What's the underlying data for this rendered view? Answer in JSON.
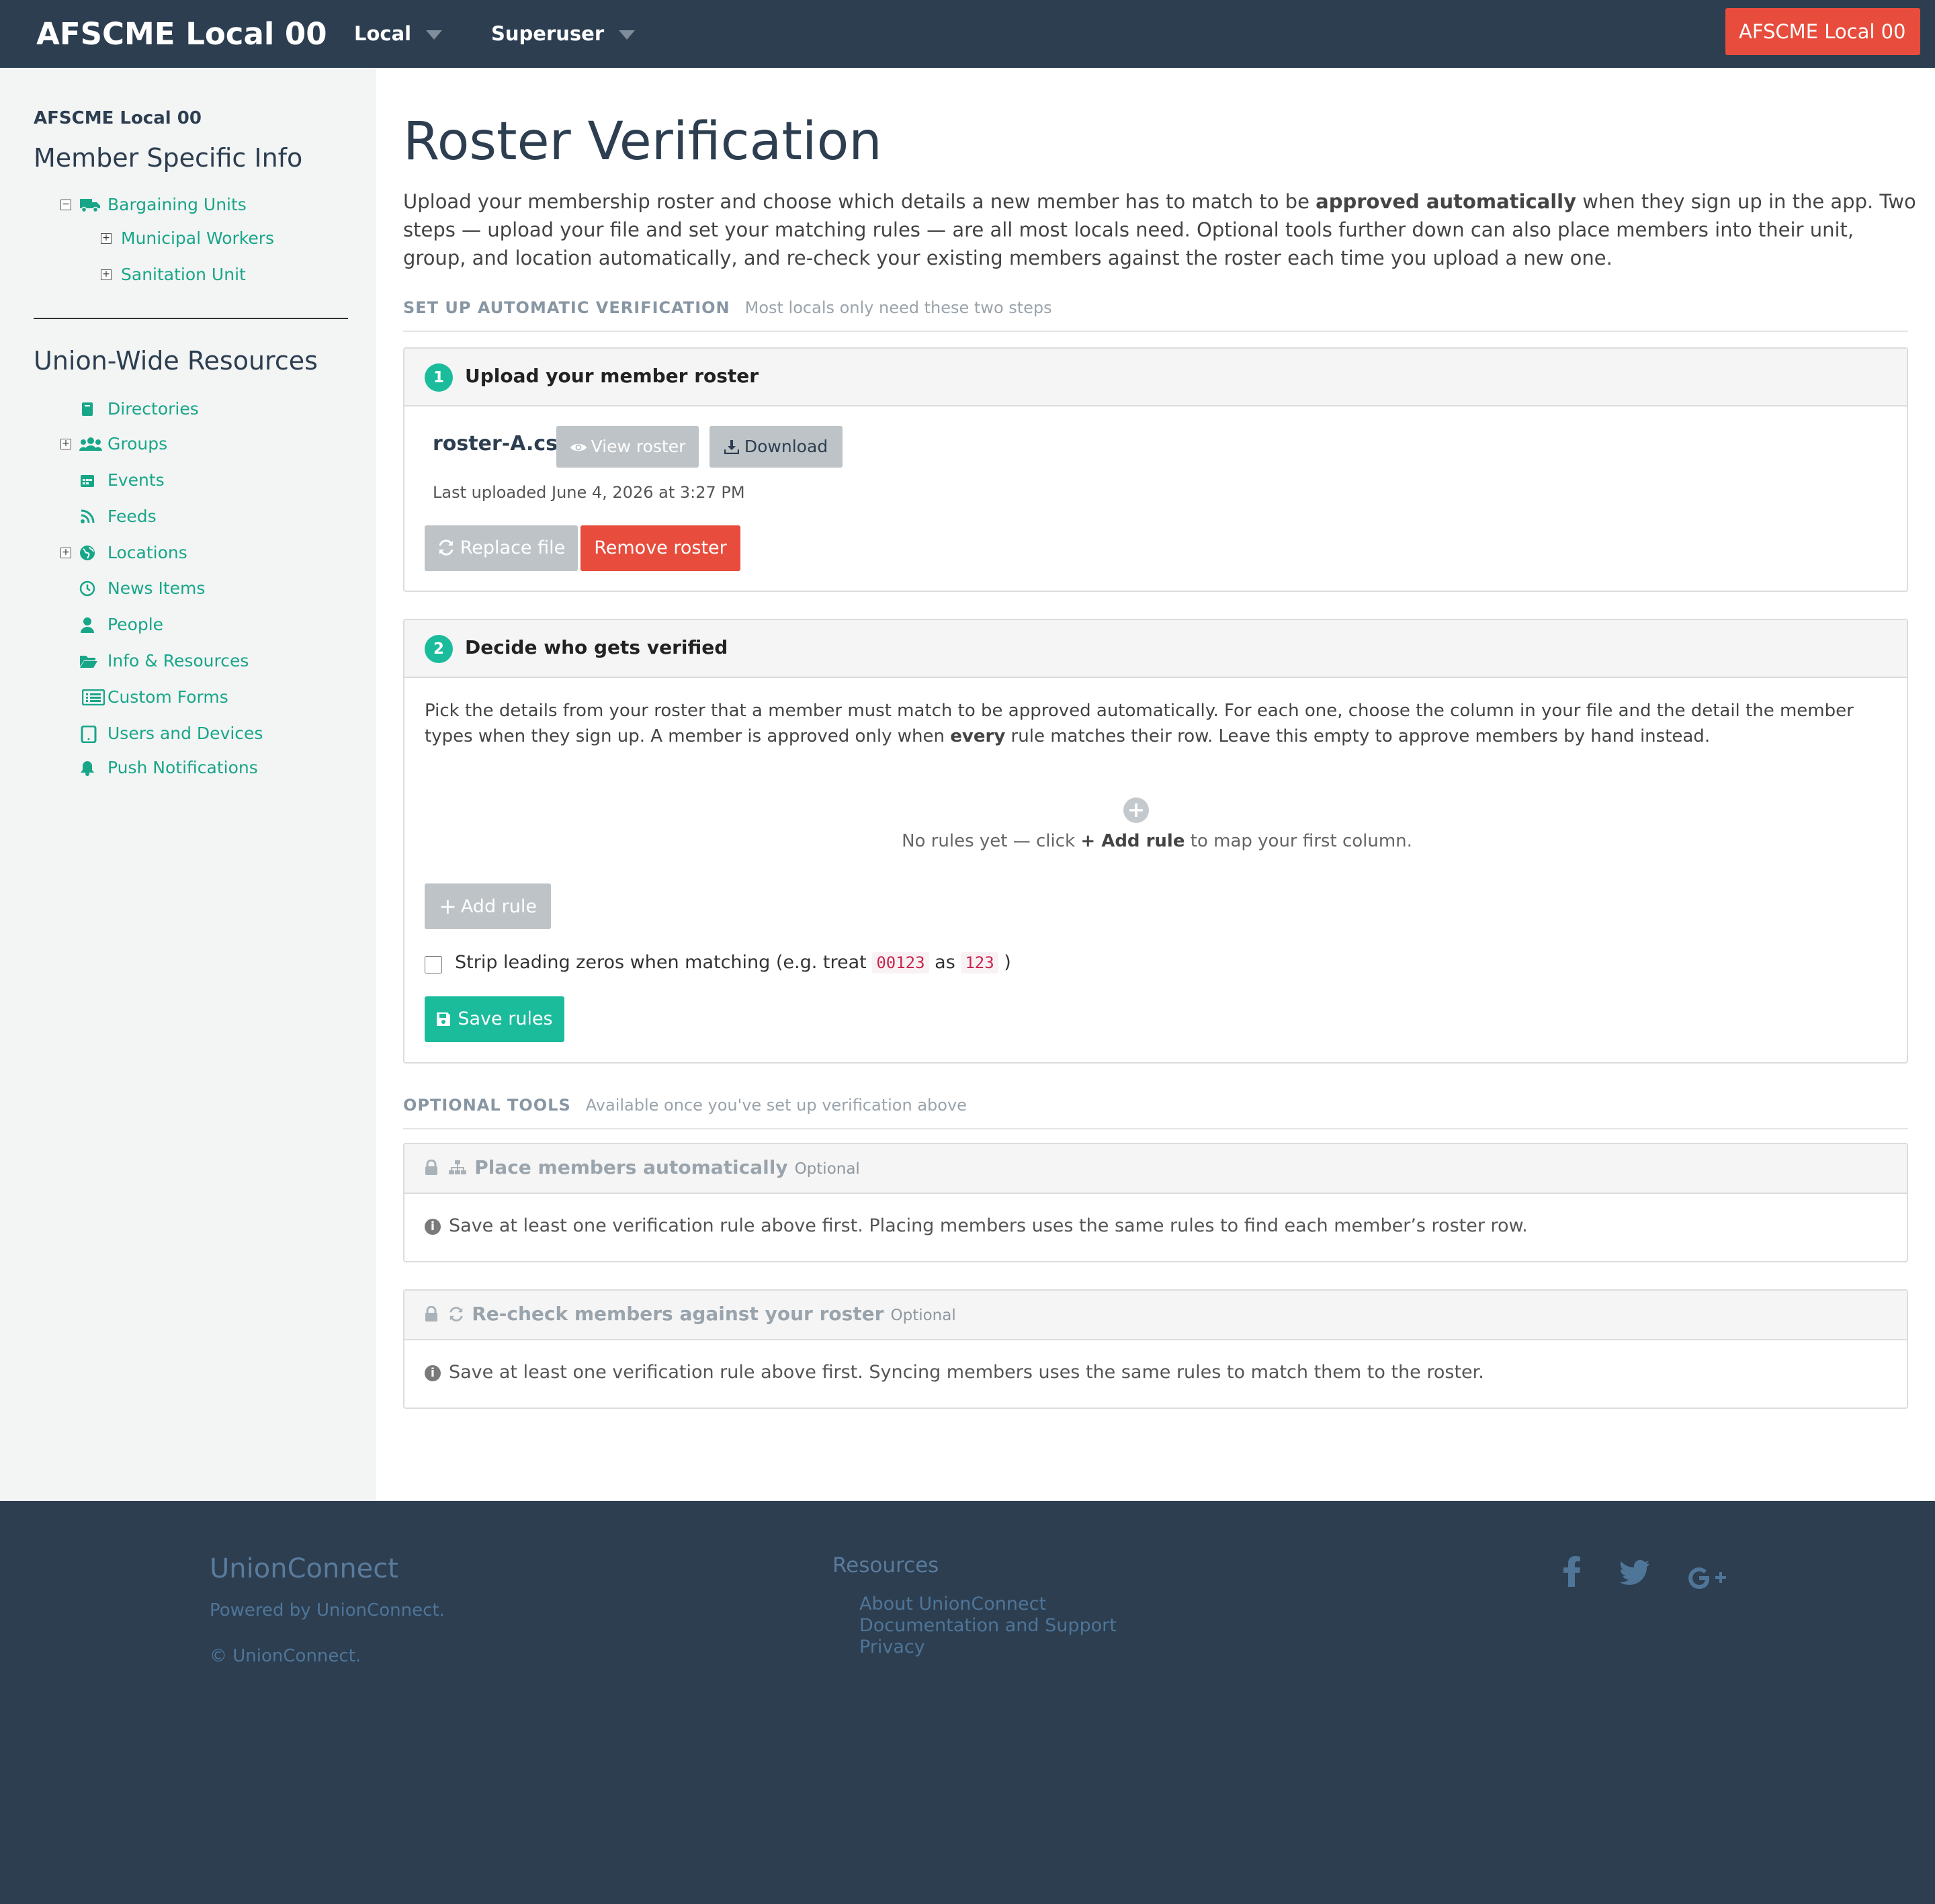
{
  "navbar": {
    "brand": "AFSCME Local 00",
    "local_menu": "Local",
    "superuser_menu": "Superuser",
    "account_button": "AFSCME Local 00"
  },
  "sidebar": {
    "local_name": "AFSCME Local 00",
    "member_heading": "Member Specific Info",
    "bargaining_units": "Bargaining Units",
    "units": [
      "Municipal Workers",
      "Sanitation Unit"
    ],
    "union_heading": "Union-Wide Resources",
    "resources": [
      {
        "label": "Directories",
        "icon": "book-icon"
      },
      {
        "label": "Groups",
        "icon": "users-icon"
      },
      {
        "label": "Events",
        "icon": "calendar-icon"
      },
      {
        "label": "Feeds",
        "icon": "rss-icon"
      },
      {
        "label": "Locations",
        "icon": "globe-icon"
      },
      {
        "label": "News Items",
        "icon": "clock-icon"
      },
      {
        "label": "People",
        "icon": "person-icon"
      },
      {
        "label": "Info & Resources",
        "icon": "folder-icon"
      },
      {
        "label": "Custom Forms",
        "icon": "form-list-icon"
      },
      {
        "label": "Users and Devices",
        "icon": "tablet-icon"
      },
      {
        "label": "Push Notifications",
        "icon": "bell-icon"
      }
    ]
  },
  "main": {
    "title": "Roster Verification",
    "intro_part1": "Upload your membership roster and choose which details a new member has to match to be ",
    "intro_bold": "approved automatically",
    "intro_part2": " when they sign up in the app. Two steps — upload your file and set your matching rules — are all most locals need. Optional tools further down can also place members into their unit, group, and location automatically, and re-check your existing members against the roster each time you upload a new one.",
    "setup_section": {
      "label": "SET UP AUTOMATIC VERIFICATION",
      "sub": "Most locals only need these two steps"
    },
    "step1": {
      "number": "1",
      "title": "Upload your member roster",
      "filename": "roster-A.csv",
      "view_button": "View roster",
      "download_button": "Download",
      "last_uploaded": "Last uploaded June 4, 2026 at 3:27 PM",
      "replace_button": "Replace file",
      "remove_button": "Remove roster"
    },
    "step2": {
      "number": "2",
      "title": "Decide who gets verified",
      "desc_part1": "Pick the details from your roster that a member must match to be approved automatically. For each one, choose the column in your file and the detail the member types when they sign up. A member is approved only when ",
      "desc_bold": "every",
      "desc_part2": " rule matches their row. Leave this empty to approve members by hand instead.",
      "empty_part1": "No rules yet — click ",
      "empty_bold": "+ Add rule",
      "empty_part2": " to map your first column.",
      "add_rule_button": "Add rule",
      "strip_label_part1": "Strip leading zeros when matching (e.g. treat ",
      "strip_code1": "00123",
      "strip_label_part2": " as ",
      "strip_code2": "123",
      "strip_label_part3": " )",
      "strip_checked": false,
      "save_button": "Save rules"
    },
    "optional_section": {
      "label": "OPTIONAL TOOLS",
      "sub": "Available once you've set up verification above"
    },
    "place_panel": {
      "title": "Place members automatically",
      "tag": "Optional",
      "message": "Save at least one verification rule above first. Placing members uses the same rules to find each member’s roster row."
    },
    "recheck_panel": {
      "title": "Re-check members against your roster",
      "tag": "Optional",
      "message": "Save at least one verification rule above first. Syncing members uses the same rules to match them to the roster."
    }
  },
  "footer": {
    "brand": "UnionConnect",
    "powered": "Powered by UnionConnect.",
    "copyright": "© UnionConnect.",
    "resources_heading": "Resources",
    "links": [
      "About UnionConnect",
      "Documentation and Support",
      "Privacy"
    ],
    "social": [
      "facebook-icon",
      "twitter-icon",
      "google-plus-icon"
    ]
  },
  "colors": {
    "navbar": "#2c3e50",
    "accent": "#1abc9c",
    "danger": "#e74c3c",
    "link": "#18a689"
  }
}
